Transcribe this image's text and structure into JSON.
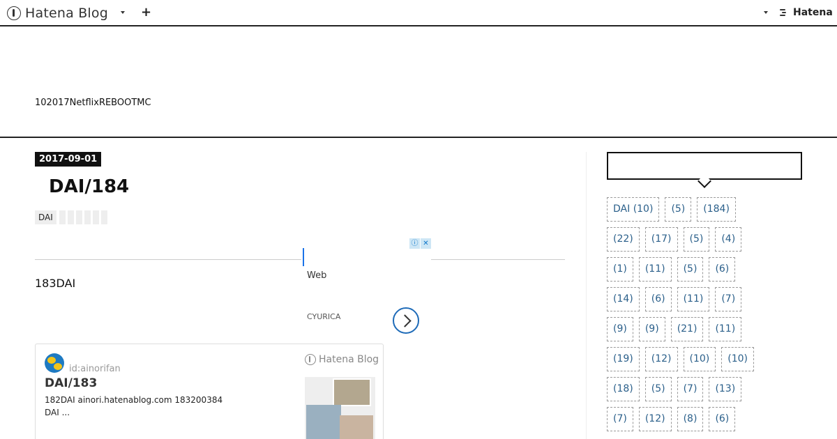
{
  "topbar": {
    "logo_text": "Hatena Blog",
    "plus_label": "+",
    "brand_text": "Hatena"
  },
  "header": {
    "description": "102017NetflixREBOOTMC"
  },
  "entry": {
    "date": "2017-09-01",
    "title": "DAI/184",
    "category": "DAI",
    "body": "183DAI"
  },
  "ad": {
    "line1": "Web",
    "line2": "CYURICA",
    "info_icon": "ⓘ",
    "close_icon": "✕"
  },
  "embed": {
    "user": "id:ainorifan",
    "brand": "Hatena Blog",
    "title": "DAI/183",
    "desc_line1": "182DAI ainori.hatenablog.com 183200384",
    "desc_line2": "DAI ..."
  },
  "sidebar": {
    "heading": "",
    "tag_rows": [
      [
        "DAI (10)",
        "(5)",
        "(184)"
      ],
      [
        "(22)",
        "(17)",
        "(5)",
        "(4)"
      ],
      [
        "(1)",
        "(11)",
        "(5)",
        "(6)"
      ],
      [
        "(14)",
        "(6)",
        "(11)",
        "(7)"
      ],
      [
        "(9)",
        "(9)",
        "(21)",
        "(11)"
      ],
      [
        "(19)",
        "(12)",
        "(10)",
        "(10)"
      ],
      [
        "(18)",
        "(5)",
        "(7)",
        "(13)"
      ],
      [
        "(7)",
        "(12)",
        "(8)",
        "(6)"
      ]
    ]
  },
  "colors": {
    "tag_text": "#2a5f8a",
    "date_badge_bg": "#111111",
    "ad_arrow": "#1e6bb8"
  }
}
